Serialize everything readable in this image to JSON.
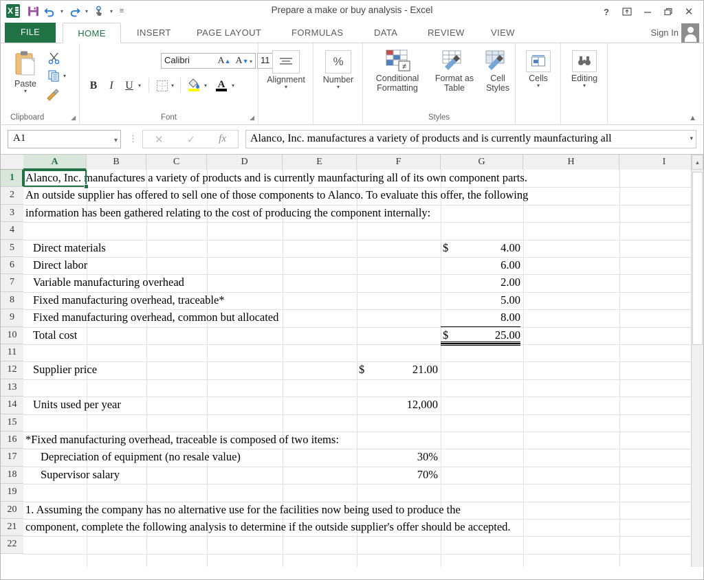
{
  "window": {
    "title": "Prepare a make or buy analysis - Excel",
    "help_icon": "?",
    "ribbon_display_icon": "ribbon-display-options-icon",
    "minimize_icon": "–",
    "restore_icon": "restore-icon",
    "close_icon": "✕"
  },
  "qat": {
    "app_icon": "excel-logo-icon",
    "save_icon": "save-icon",
    "undo_icon": "undo-icon",
    "redo_icon": "redo-icon",
    "touch_mode_icon": "touch-mouse-mode-icon",
    "customize_icon": "customize-quick-access-toolbar-icon"
  },
  "tabs": [
    {
      "label": "FILE",
      "active": false
    },
    {
      "label": "HOME",
      "active": true
    },
    {
      "label": "INSERT",
      "active": false
    },
    {
      "label": "PAGE LAYOUT",
      "active": false
    },
    {
      "label": "FORMULAS",
      "active": false
    },
    {
      "label": "DATA",
      "active": false
    },
    {
      "label": "REVIEW",
      "active": false
    },
    {
      "label": "VIEW",
      "active": false
    }
  ],
  "account": {
    "sign_in": "Sign In",
    "avatar_icon": "user-avatar-icon"
  },
  "ribbon": {
    "groups": [
      {
        "name": "Clipboard",
        "label": "Clipboard"
      },
      {
        "name": "Font",
        "label": "Font"
      },
      {
        "name": "Alignment",
        "label": ""
      },
      {
        "name": "Number",
        "label": ""
      },
      {
        "name": "Styles",
        "label": "Styles"
      },
      {
        "name": "Cells",
        "label": ""
      },
      {
        "name": "Editing",
        "label": ""
      }
    ],
    "clipboard": {
      "paste_label": "Paste",
      "paste_icon": "paste-icon",
      "cut_icon": "cut-scissors-icon",
      "copy_icon": "copy-icon",
      "format_painter_icon": "format-painter-icon",
      "dialog_launcher_icon": "dialog-box-launcher-icon"
    },
    "font": {
      "font_name": "Calibri",
      "font_size": "11",
      "grow_font_icon": "increase-font-size-icon",
      "shrink_font_icon": "decrease-font-size-icon",
      "bold": "B",
      "italic": "I",
      "underline": "U",
      "borders_icon": "borders-icon",
      "fill_color_icon": "fill-color-icon",
      "font_color_icon": "font-color-icon",
      "dialog_launcher_icon": "dialog-box-launcher-icon"
    },
    "alignment": {
      "label": "Alignment",
      "icon": "alignment-icon"
    },
    "number": {
      "label": "Number",
      "icon": "percent-icon"
    },
    "styles": {
      "conditional_formatting": "Conditional Formatting",
      "conditional_formatting_icon": "conditional-formatting-icon",
      "format_as_table": "Format as Table",
      "format_as_table_icon": "format-as-table-icon",
      "cell_styles": "Cell Styles",
      "cell_styles_icon": "cell-styles-icon"
    },
    "cells": {
      "label": "Cells",
      "icon": "cells-icon"
    },
    "editing": {
      "label": "Editing",
      "icon": "find-binoculars-icon"
    },
    "collapse_ribbon_icon": "collapse-ribbon-chevron-icon"
  },
  "formula_bar": {
    "name_box": "A1",
    "name_box_dropdown_icon": "chevron-down-icon",
    "cancel_icon": "✕",
    "enter_icon": "✓",
    "function_icon": "fx",
    "content": "Alanco, Inc. manufactures a variety of products and is currently maunfacturing all",
    "expand_icon": "expand-formula-bar-icon"
  },
  "grid": {
    "columns": [
      "A",
      "B",
      "C",
      "D",
      "E",
      "F",
      "G",
      "H",
      "I"
    ],
    "selected_cell": "A1",
    "rows": [
      1,
      2,
      3,
      4,
      5,
      6,
      7,
      8,
      9,
      10,
      11,
      12,
      13,
      14,
      15,
      16,
      17,
      18,
      19,
      20,
      21,
      22
    ],
    "cells": [
      {
        "row": 1,
        "col": "A",
        "text": "Alanco, Inc. manufactures a variety of products and is currently maunfacturing all of its own component parts.",
        "align": "left",
        "indent": 0,
        "style": ""
      },
      {
        "row": 2,
        "col": "A",
        "text": "An outside supplier has offered to sell one of those components to Alanco.  To evaluate this offer, the following",
        "align": "left",
        "indent": 0,
        "style": ""
      },
      {
        "row": 3,
        "col": "A",
        "text": "information has been gathered relating to the cost of producing the component internally:",
        "align": "left",
        "indent": 0,
        "style": ""
      },
      {
        "row": 5,
        "col": "A",
        "text": "Direct materials",
        "align": "left",
        "indent": 1,
        "style": ""
      },
      {
        "row": 5,
        "col": "G",
        "text": "$",
        "align": "left",
        "indent": 0,
        "style": ""
      },
      {
        "row": 5,
        "col": "G",
        "text": "4.00",
        "align": "right",
        "indent": 0,
        "style": ""
      },
      {
        "row": 6,
        "col": "A",
        "text": "Direct labor",
        "align": "left",
        "indent": 1,
        "style": ""
      },
      {
        "row": 6,
        "col": "G",
        "text": "6.00",
        "align": "right",
        "indent": 0,
        "style": ""
      },
      {
        "row": 7,
        "col": "A",
        "text": "Variable manufacturing overhead",
        "align": "left",
        "indent": 1,
        "style": ""
      },
      {
        "row": 7,
        "col": "G",
        "text": "2.00",
        "align": "right",
        "indent": 0,
        "style": ""
      },
      {
        "row": 8,
        "col": "A",
        "text": "Fixed manufacturing overhead, traceable*",
        "align": "left",
        "indent": 1,
        "style": ""
      },
      {
        "row": 8,
        "col": "G",
        "text": "5.00",
        "align": "right",
        "indent": 0,
        "style": ""
      },
      {
        "row": 9,
        "col": "A",
        "text": "Fixed manufacturing overhead, common but allocated",
        "align": "left",
        "indent": 1,
        "style": ""
      },
      {
        "row": 9,
        "col": "G",
        "text": "8.00",
        "align": "right",
        "indent": 0,
        "style": "border-bottom-single"
      },
      {
        "row": 10,
        "col": "A",
        "text": "Total cost",
        "align": "left",
        "indent": 1,
        "style": ""
      },
      {
        "row": 10,
        "col": "G",
        "text": "$",
        "align": "left",
        "indent": 0,
        "style": "border-bottom-double"
      },
      {
        "row": 10,
        "col": "G",
        "text": "25.00",
        "align": "right",
        "indent": 0,
        "style": "border-bottom-double"
      },
      {
        "row": 12,
        "col": "A",
        "text": "Supplier price",
        "align": "left",
        "indent": 1,
        "style": ""
      },
      {
        "row": 12,
        "col": "F",
        "text": "$",
        "align": "left",
        "indent": 0,
        "style": ""
      },
      {
        "row": 12,
        "col": "F",
        "text": "21.00",
        "align": "right",
        "indent": 0,
        "style": ""
      },
      {
        "row": 14,
        "col": "A",
        "text": "Units used per year",
        "align": "left",
        "indent": 1,
        "style": ""
      },
      {
        "row": 14,
        "col": "F",
        "text": "12,000",
        "align": "right",
        "indent": 0,
        "style": ""
      },
      {
        "row": 16,
        "col": "A",
        "text": "*Fixed manufacturing overhead, traceable is composed of two items:",
        "align": "left",
        "indent": 0,
        "style": ""
      },
      {
        "row": 17,
        "col": "A",
        "text": "Depreciation of equipment (no resale value)",
        "align": "left",
        "indent": 2,
        "style": ""
      },
      {
        "row": 17,
        "col": "F",
        "text": "30%",
        "align": "right",
        "indent": 0,
        "style": ""
      },
      {
        "row": 18,
        "col": "A",
        "text": "Supervisor salary",
        "align": "left",
        "indent": 2,
        "style": ""
      },
      {
        "row": 18,
        "col": "F",
        "text": "70%",
        "align": "right",
        "indent": 0,
        "style": ""
      },
      {
        "row": 20,
        "col": "A",
        "text": "1. Assuming the company has no alternative use for the facilities now being used to produce the",
        "align": "left",
        "indent": 0,
        "style": ""
      },
      {
        "row": 21,
        "col": "A",
        "text": "component, complete the following analysis to determine if the outside supplier's offer should be accepted.",
        "align": "left",
        "indent": 0,
        "style": ""
      }
    ],
    "scrollbar": {
      "up_arrow_icon": "scroll-up-arrow-icon"
    }
  },
  "colors": {
    "accent": "#217346",
    "file_tab": "#217346",
    "selection": "#217346"
  }
}
